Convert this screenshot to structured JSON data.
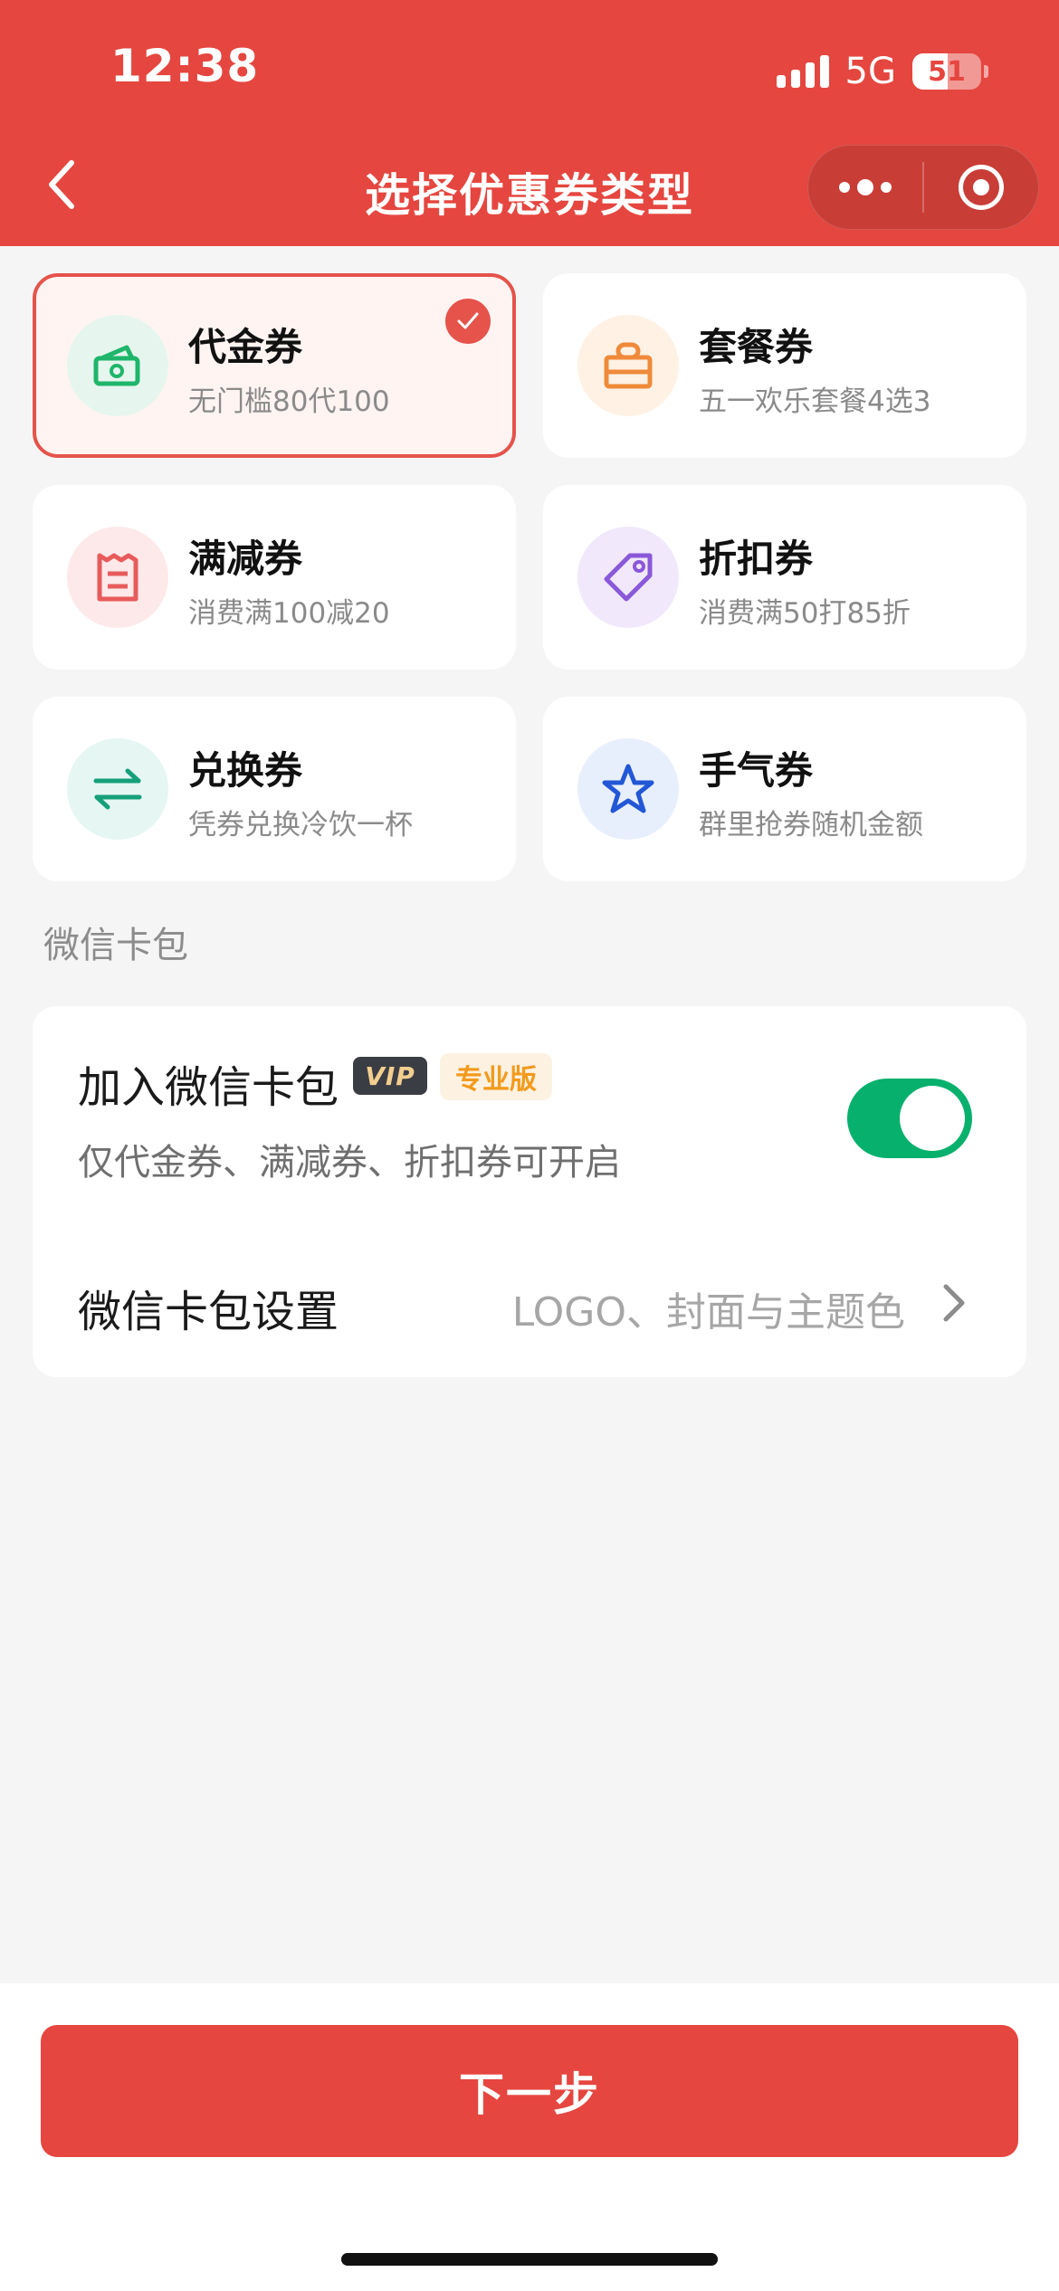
{
  "status_bar": {
    "time": "12:38",
    "network": "5G",
    "battery": "51",
    "battery_level_percent": 51
  },
  "nav": {
    "title": "选择优惠券类型",
    "back_icon": "chevron-left-icon",
    "more_icon": "more-dots-icon",
    "close_icon": "target-circle-icon"
  },
  "coupon_types": [
    {
      "title": "代金券",
      "subtitle": "无门槛80代100",
      "icon": "cash-icon",
      "selected": true,
      "icon_color": "#1fb56a",
      "icon_bg": "#e6f6ee"
    },
    {
      "title": "套餐券",
      "subtitle": "五一欢乐套餐4选3",
      "icon": "gift-box-icon",
      "selected": false,
      "icon_color": "#ef8a3a",
      "icon_bg": "#fff1e4"
    },
    {
      "title": "满减券",
      "subtitle": "消费满100减20",
      "icon": "receipt-icon",
      "selected": false,
      "icon_color": "#e85b5b",
      "icon_bg": "#fde9ea"
    },
    {
      "title": "折扣券",
      "subtitle": "消费满50打85折",
      "icon": "price-tag-icon",
      "selected": false,
      "icon_color": "#8a58d9",
      "icon_bg": "#f1e8fc"
    },
    {
      "title": "兑换券",
      "subtitle": "凭券兑换冷饮一杯",
      "icon": "exchange-arrows-icon",
      "selected": false,
      "icon_color": "#16a07a",
      "icon_bg": "#e5f6f3"
    },
    {
      "title": "手气券",
      "subtitle": "群里抢券随机金额",
      "icon": "star-icon",
      "selected": false,
      "icon_color": "#2357d6",
      "icon_bg": "#e8effc"
    }
  ],
  "wechat_section": {
    "label": "微信卡包",
    "add_title": "加入微信卡包",
    "vip_badge": "VIP",
    "pro_badge": "专业版",
    "add_desc": "仅代金券、满减券、折扣券可开启",
    "toggle_on": true,
    "settings_title": "微信卡包设置",
    "settings_value": "LOGO、封面与主题色"
  },
  "footer": {
    "next_label": "下一步"
  },
  "colors": {
    "brand": "#e5463f",
    "toggle_on": "#07b06c",
    "vip_bg": "#3b3d44",
    "pro_text": "#f39a1b"
  }
}
